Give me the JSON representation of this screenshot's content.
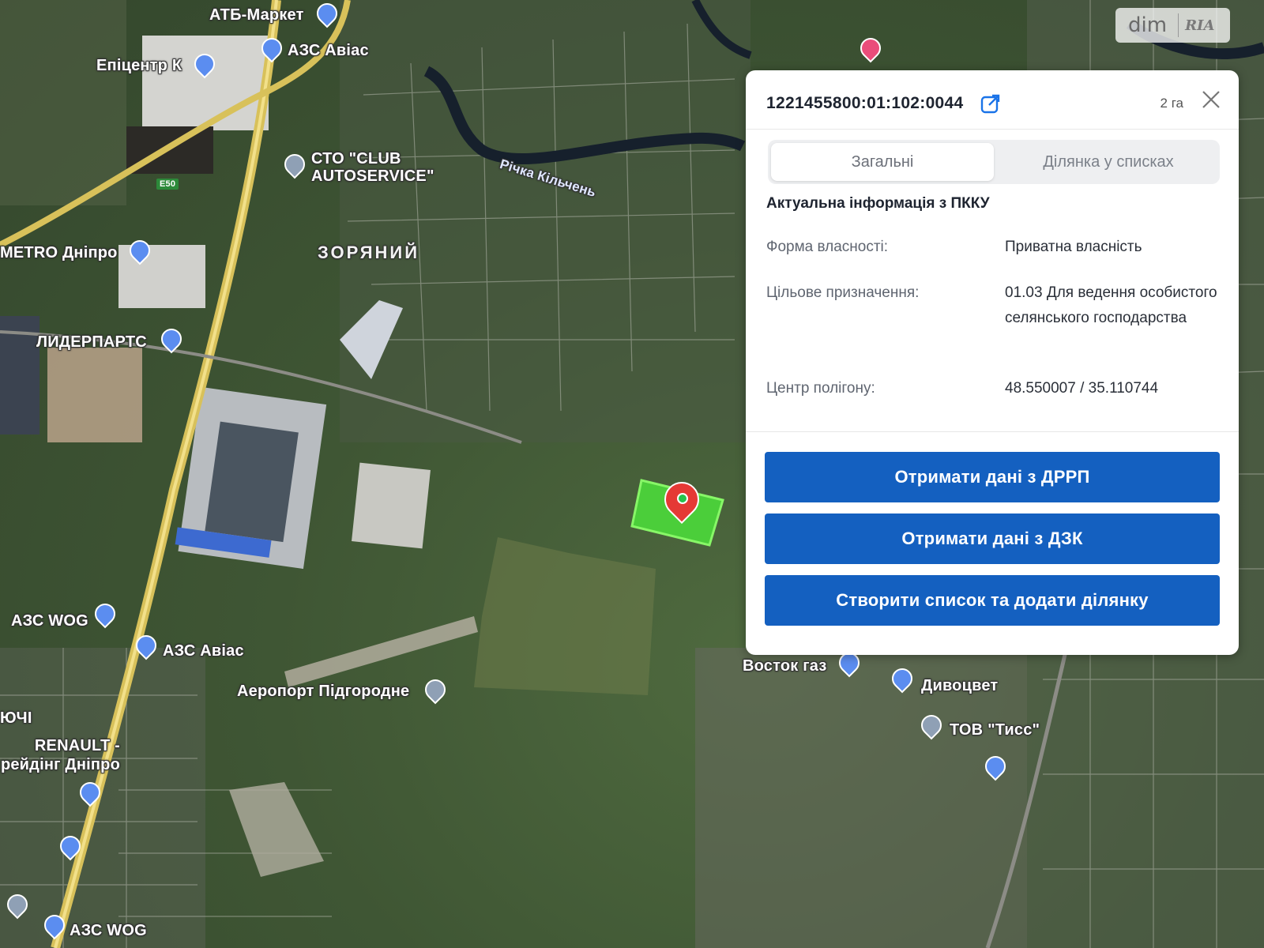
{
  "watermark": {
    "brand_left": "dim",
    "brand_right": "RIA"
  },
  "map": {
    "labels": {
      "atb": "АТБ-Маркет",
      "avias_top": "АЗС Авіас",
      "epicentr": "Епіцентр К",
      "sto": "СТО \"CLUB\nAUTOSERVICE\"",
      "river": "Річка Кільчень",
      "metro": "METRO Дніпро",
      "zoryanyi": "ЗОРЯНИЙ",
      "liderparts": "ЛИДЕРПАРТС",
      "azs_wog_1": "АЗС WOG",
      "azs_avias_2": "АЗС Авіас",
      "airport": "Аеропорт Підгородне",
      "yuchi": "ЮЧІ",
      "renault": "RENAULT -\nрейдінг Дніпро",
      "vostok": "Восток газ",
      "dyvotsvet": "Дивоцвет",
      "tov": "ТОВ \"Тисс\"",
      "azs_wog_2": "АЗС WOG",
      "e50": "E50"
    }
  },
  "panel": {
    "cadastral_number": "1221455800:01:102:0044",
    "area": "2 га",
    "tabs": [
      "Загальні",
      "Ділянка у списках"
    ],
    "active_tab": 0,
    "section_title": "Актуальна інформація з ПККУ",
    "rows": [
      {
        "key": "Форма власності:",
        "value": "Приватна власність"
      },
      {
        "key": "Цільове призначення:",
        "value": "01.03 Для ведення особистого селянського господарства"
      },
      {
        "key": "Центр полігону:",
        "value": "48.550007 / 35.110744"
      }
    ],
    "buttons": [
      "Отримати дані з ДРРП",
      "Отримати дані з ДЗК",
      "Створити список та додати ділянку"
    ]
  },
  "colors": {
    "primary_button": "#1460c0",
    "parcel_fill": "#4cd43a",
    "marker": "#e53935"
  }
}
